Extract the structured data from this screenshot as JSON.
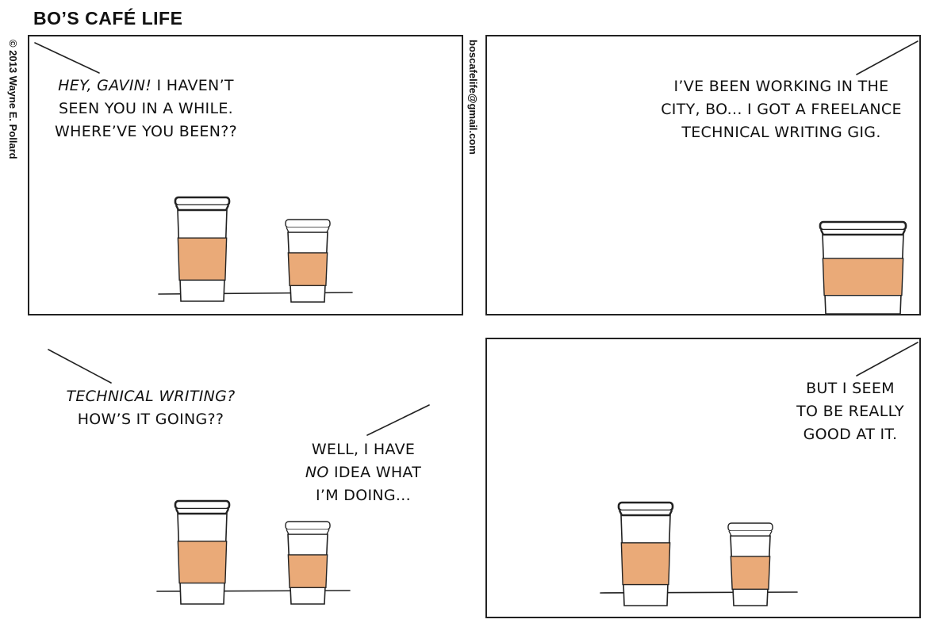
{
  "comic": {
    "title": "BO’S CAFÉ LIFE",
    "copyright": "© 2013 Wayne E. Pollard",
    "email": "boscafelife@gmail.com"
  },
  "colors": {
    "sleeve": "#eaaa78",
    "ink": "#222222",
    "paper": "#ffffff"
  },
  "panels": [
    {
      "lines": [
        {
          "em": "HEY, GAVIN!",
          "rest": " I HAVEN’T"
        },
        {
          "text": "SEEN YOU IN A WHILE."
        },
        {
          "text": "WHERE’VE YOU BEEN??"
        }
      ]
    },
    {
      "lines": [
        {
          "text": "I’VE BEEN WORKING IN THE"
        },
        {
          "text": "CITY, BO... I GOT A FREELANCE"
        },
        {
          "text": "TECHNICAL WRITING GIG."
        }
      ]
    },
    {
      "lines_a": [
        {
          "em": "TECHNICAL WRITING?"
        },
        {
          "text": "HOW’S IT GOING??"
        }
      ],
      "lines_b": [
        {
          "text": "WELL, I HAVE"
        },
        {
          "em": "NO",
          "rest": " IDEA WHAT"
        },
        {
          "text": "I’M DOING..."
        }
      ]
    },
    {
      "lines": [
        {
          "text": "BUT I SEEM"
        },
        {
          "text": "TO BE REALLY"
        },
        {
          "text": "GOOD AT IT."
        }
      ]
    }
  ]
}
